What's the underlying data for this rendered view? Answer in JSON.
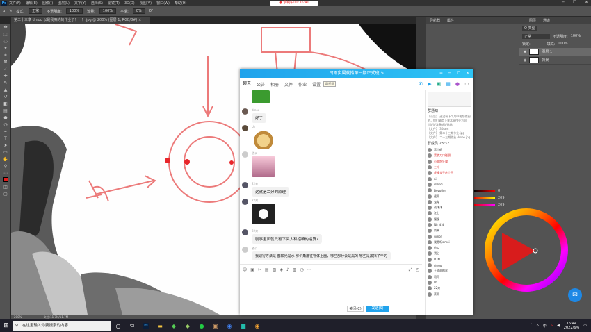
{
  "recording_badge": "● 录制中00:36:40",
  "ps_menu": [
    "文件(F)",
    "编辑(E)",
    "图像(I)",
    "图层(L)",
    "文字(Y)",
    "选择(S)",
    "滤镜(T)",
    "3D(D)",
    "视图(V)",
    "窗口(W)",
    "帮助(H)"
  ],
  "options": {
    "mode_label": "模式:",
    "mode_value": "正常",
    "opacity_label": "不透明度:",
    "opacity_value": "100%",
    "flow_label": "流量:",
    "flow_value": "100%",
    "smooth_label": "平滑:",
    "smooth_value": "0%",
    "angle": "0°"
  },
  "doc_tab": "第二十三章 dmoo 以是我嘛的的作业了！！！.jpg @ 200% (图层 1, RGB/8#) ×",
  "status_zoom": "200%",
  "status_doc": "文档:11.7M/11.7M",
  "panel_tabs_left": [
    "导航器",
    "属性"
  ],
  "panel_tabs_right": [
    "图层",
    "通道"
  ],
  "layers": {
    "kind_label": "Q 类型",
    "blend": "正常",
    "opacity_label": "不透明度:",
    "opacity": "100%",
    "lock_label": "锁定:",
    "fill_label": "填充:",
    "fill": "100%",
    "items": [
      {
        "name": "图层 1"
      },
      {
        "name": "背景"
      }
    ]
  },
  "color_sliders": [
    "0",
    "209",
    "209"
  ],
  "chat": {
    "title": "司雨实属就指第一期正式班 ✎",
    "tabs": [
      "聊天",
      "公告",
      "相册",
      "文件",
      "作业",
      "设置"
    ],
    "tooltip": "群视频",
    "messages": [
      {
        "name": "dmoo",
        "text": "好了"
      },
      {
        "name": "Uz",
        "text": ""
      },
      {
        "name": "依公",
        "text": ""
      },
      {
        "name": "22来",
        "text": "这就是二分的原理"
      },
      {
        "name": "22来",
        "text": ""
      },
      {
        "name": "22来",
        "text": "剧事里面就只有下买大和招嘛的运算?"
      },
      {
        "name": "依公",
        "text": "我记得方法是 都知光是水 那个角度往物体上面，哪些部分会是黑的 哪些是黑挡了干的"
      }
    ],
    "close_label": "关闭(C)",
    "send_label": "发送(S)",
    "notice_title": "群通知",
    "notice_lines": [
      "【公告】 还没有下个月中视频作业的",
      "的，你们确定下来本周作业方向",
      "当好好准备好好练练",
      "【文件】 30ram",
      "【文件】 第二十三期作业.jpg",
      "【文件】 二十三期作业 dmoo.jpg"
    ],
    "members_title": "群成员 23/32",
    "members": [
      "黑小鹤",
      "黑夜刀口碰朋",
      "小鹿吃狂魔",
      "三叶",
      "虎嗅宝子吃个子",
      "ni",
      "dlilisoi",
      "Devotion",
      "遥雨",
      "鬼鬼",
      "谈沐沐",
      "江上",
      "慢慢",
      "Nü 就就",
      "简单",
      "simon",
      "我嗯呀simoi",
      "依公",
      "我心",
      "DTM",
      "dmoo",
      "王武雨格丝",
      "司司",
      "Uz",
      "22来",
      "蔡雨"
    ]
  },
  "taskbar": {
    "search_placeholder": "在这里输入你要搜索的内容",
    "time": "15:44",
    "date": "2022/6/6",
    "ime": "中"
  }
}
